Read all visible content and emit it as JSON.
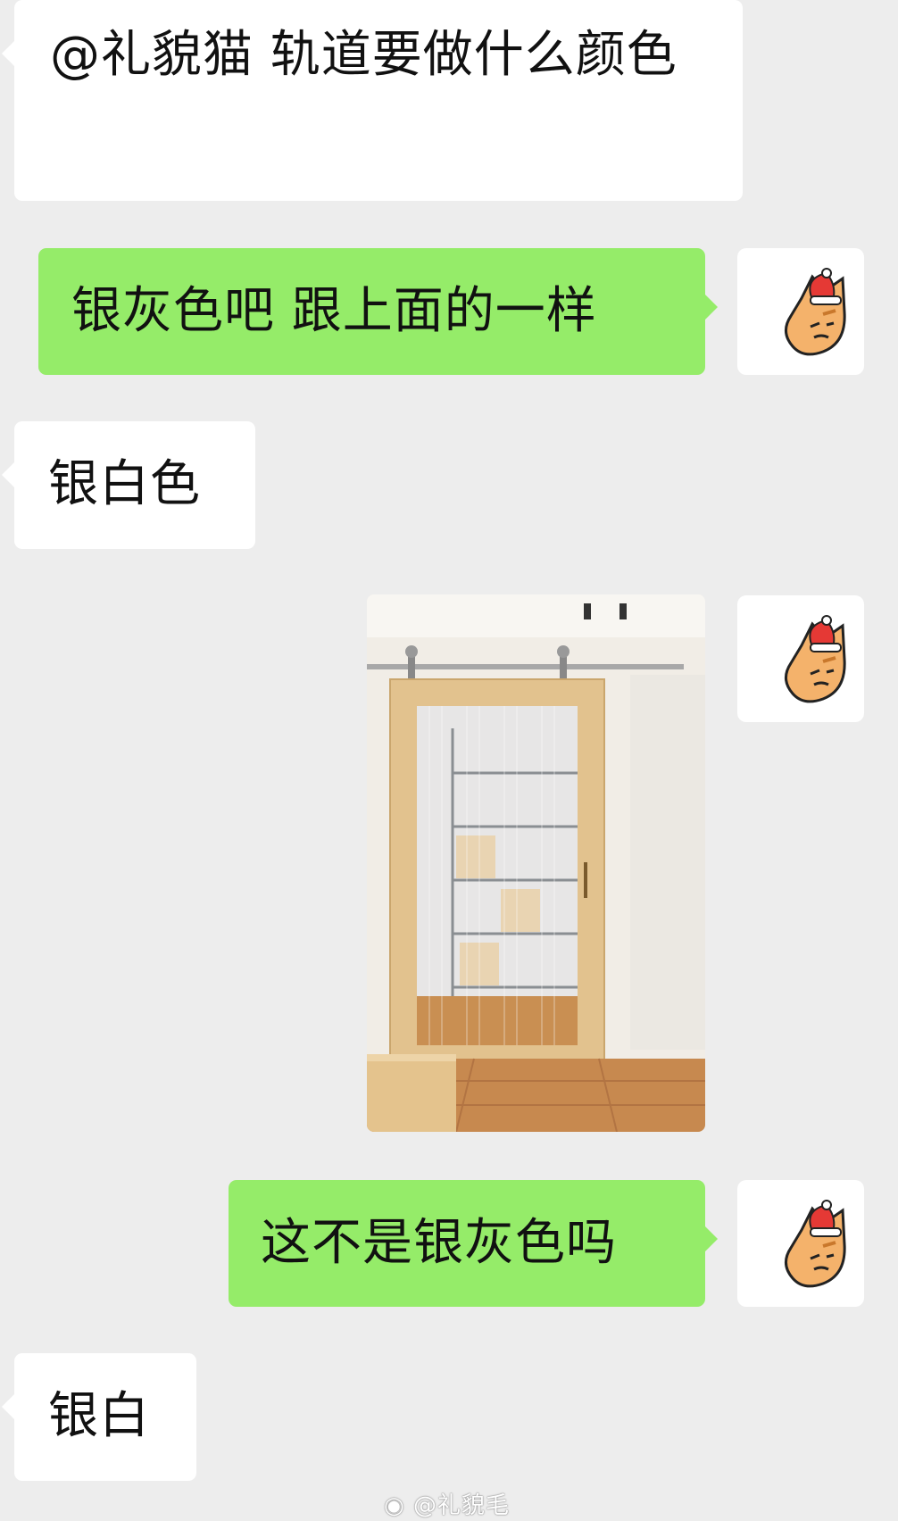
{
  "messages": [
    {
      "side": "in",
      "text": "@礼貌猫 轨道要做什么颜色"
    },
    {
      "side": "out",
      "text": "银灰色吧 跟上面的一样"
    },
    {
      "side": "in",
      "text": "银白色"
    },
    {
      "side": "out",
      "type": "image",
      "alt": "sliding-barn-door-photo"
    },
    {
      "side": "out",
      "text": "这不是银灰色吗"
    },
    {
      "side": "in",
      "text": "银白"
    }
  ],
  "watermark": "@礼貌毛",
  "icons": {
    "avatar": "cat-with-santa-hat-avatar",
    "watermark": "weibo-logo-icon"
  },
  "colors": {
    "background": "#ededed",
    "incoming_bubble": "#ffffff",
    "outgoing_bubble": "#95ec69",
    "text": "#111111"
  }
}
